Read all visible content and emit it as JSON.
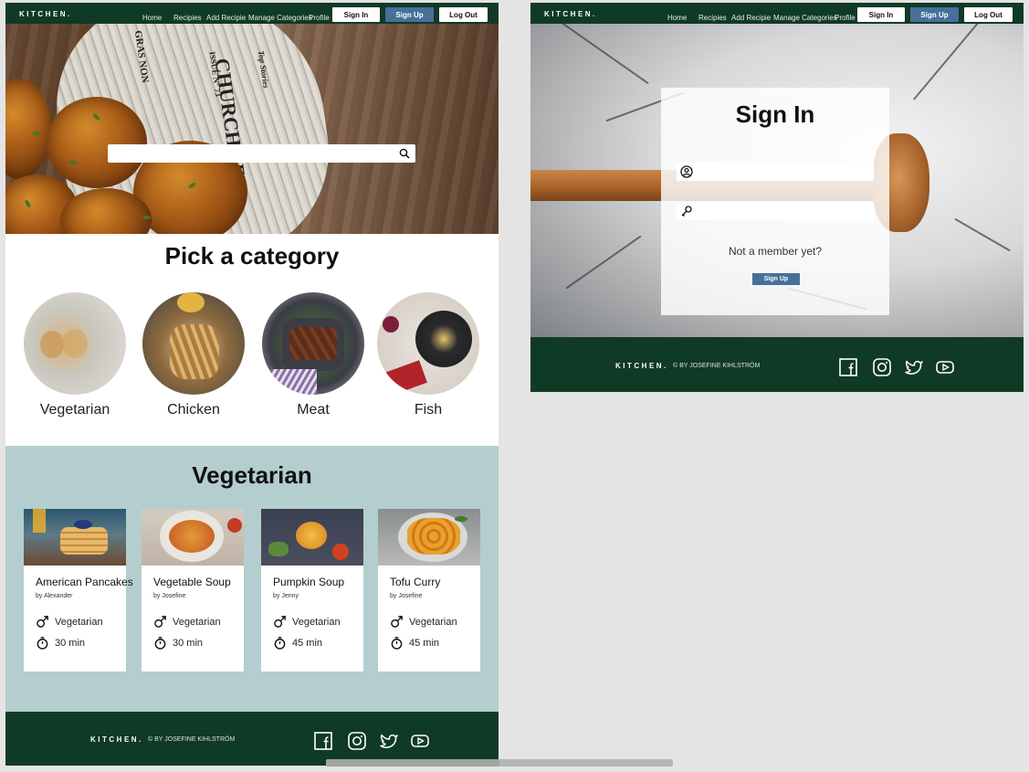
{
  "nav": {
    "brand": "KITCHEN.",
    "links": [
      "Home",
      "Recipies",
      "Add Recipie",
      "Manage Categories",
      "Profile"
    ],
    "sign_in": "Sign In",
    "sign_up": "Sign Up",
    "log_out": "Log Out"
  },
  "hero": {
    "search_placeholder": "",
    "newspaper_text": [
      "CHURCH FE",
      "ISSUE N° 73",
      "Top Stories",
      "GRAS NON"
    ]
  },
  "categories": {
    "title": "Pick a category",
    "items": [
      {
        "label": "Vegetarian"
      },
      {
        "label": "Chicken"
      },
      {
        "label": "Meat"
      },
      {
        "label": "Fish"
      }
    ]
  },
  "recipes": {
    "title": "Vegetarian",
    "cards": [
      {
        "title": "American Pancakes",
        "by": "by Alexander",
        "category": "Vegetarian",
        "time": "30 min"
      },
      {
        "title": "Vegetable Soup",
        "by": "by Josefine",
        "category": "Vegetarian",
        "time": "30 min"
      },
      {
        "title": "Pumpkin Soup",
        "by": "by Jenny",
        "category": "Vegetarian",
        "time": "45 min"
      },
      {
        "title": "Tofu Curry",
        "by": "by Josefine",
        "category": "Vegetarian",
        "time": "45 min"
      }
    ]
  },
  "footer": {
    "brand": "KITCHEN.",
    "copyright": "©  BY JOSEFINE KIHLSTRÖM",
    "social": [
      "facebook-icon",
      "instagram-icon",
      "twitter-icon",
      "youtube-icon"
    ]
  },
  "signin": {
    "title": "Sign In",
    "username_placeholder": "",
    "password_placeholder": "",
    "not_member": "Not a member yet?",
    "sign_up": "Sign Up"
  },
  "colors": {
    "nav_bg": "#0f3a26",
    "accent_blue": "#46709a",
    "section_bg": "#b4cdce",
    "page_bg": "#e4e4e4"
  }
}
